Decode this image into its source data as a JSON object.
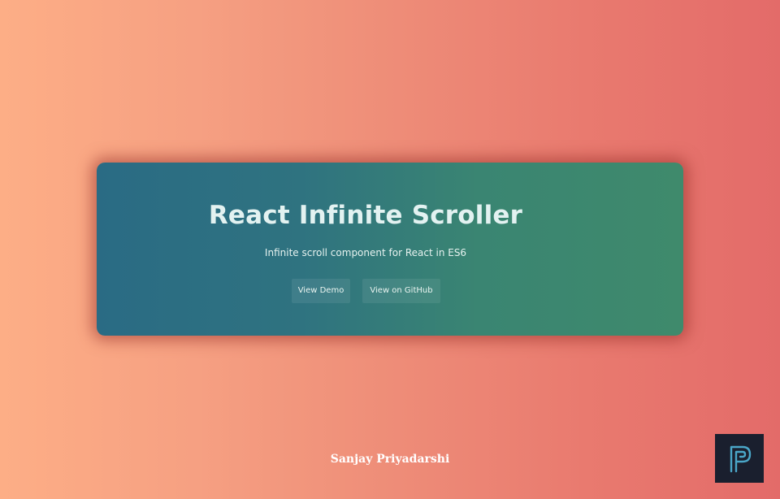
{
  "hero": {
    "title": "React Infinite Scroller",
    "subtitle": "Infinite scroll component for React in ES6",
    "buttons": {
      "demo_label": "View Demo",
      "github_label": "View on GitHub"
    }
  },
  "footer": {
    "author": "Sanjay Priyadarshi"
  },
  "logo": {
    "icon": "stylized-p-logo-icon",
    "background": "#1a1f2e",
    "stroke": "#4aa6c8"
  },
  "colors": {
    "page_gradient_start": "#fdae86",
    "page_gradient_end": "#e36b69",
    "card_gradient_start": "#2a6b84",
    "card_gradient_end": "#3f8a6c",
    "title_color": "#e3f2f1"
  }
}
